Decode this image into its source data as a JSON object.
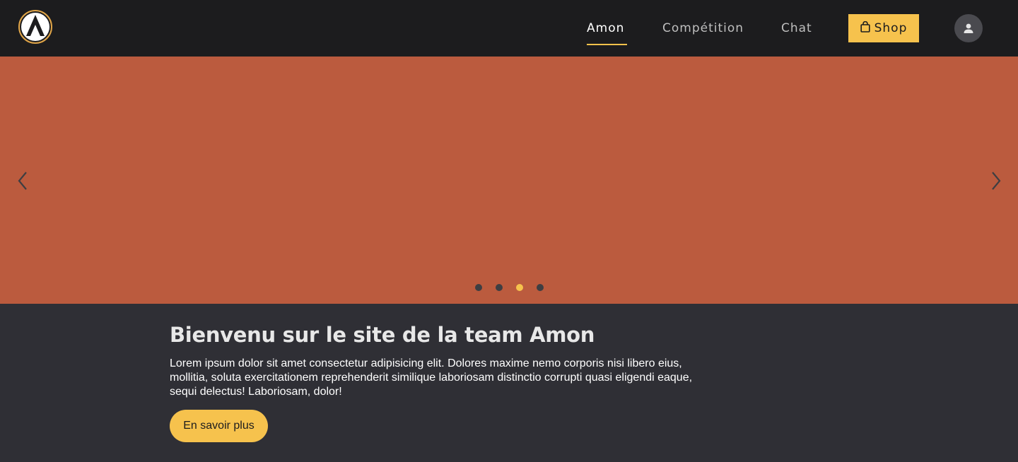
{
  "header": {
    "logo_icon": "amon-logo-icon",
    "nav": [
      {
        "label": "Amon",
        "active": true
      },
      {
        "label": "Compétition",
        "active": false
      },
      {
        "label": "Chat",
        "active": false
      }
    ],
    "shop": {
      "label": "Shop",
      "icon": "shopping-bag-icon"
    },
    "account_icon": "user-avatar-icon"
  },
  "carousel": {
    "background_color": "#bb5b3e",
    "prev_icon": "chevron-left-icon",
    "next_icon": "chevron-right-icon",
    "slide_count": 4,
    "active_slide": 3
  },
  "hero": {
    "title": "Bienvenu sur le site de la team Amon",
    "body": "Lorem ipsum dolor sit amet consectetur adipisicing elit. Dolores maxime nemo corporis nisi libero eius, mollitia, soluta exercitationem reprehenderit similique laboriosam distinctio corrupti quasi eligendi eaque, sequi delectus! Laboriosam, dolor!",
    "cta_label": "En savoir plus"
  },
  "colors": {
    "accent": "#f6c24d",
    "header_bg": "#1c1c1e",
    "page_bg": "#2f2f35"
  }
}
